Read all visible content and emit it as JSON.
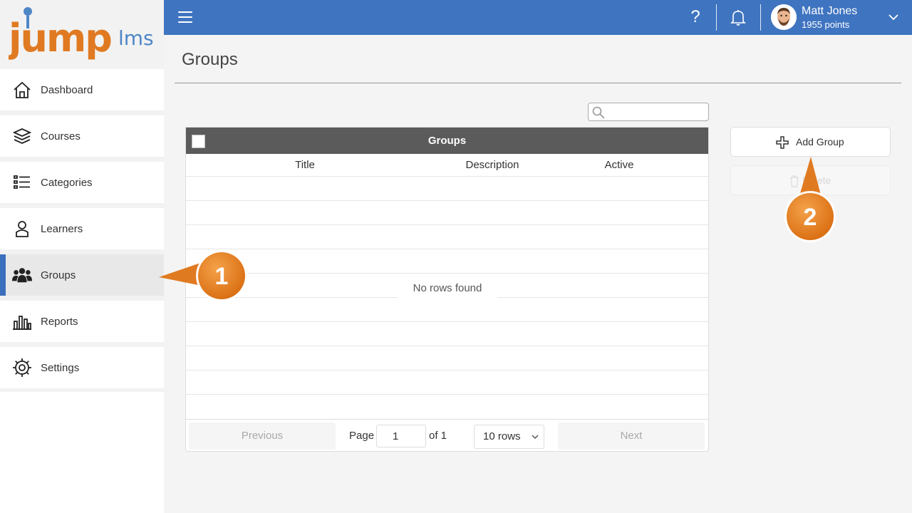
{
  "app": {
    "logo_text_main": "jump",
    "logo_text_sub": "lms",
    "colors": {
      "brand_orange": "#e07a22",
      "brand_blue": "#3f74c0",
      "callout_orange": "#e8821e"
    }
  },
  "sidebar": {
    "items": [
      {
        "label": "Dashboard",
        "icon": "home-icon",
        "active": false
      },
      {
        "label": "Courses",
        "icon": "book-stack-icon",
        "active": false
      },
      {
        "label": "Categories",
        "icon": "list-icon",
        "active": false
      },
      {
        "label": "Learners",
        "icon": "person-icon",
        "active": false
      },
      {
        "label": "Groups",
        "icon": "group-icon",
        "active": true
      },
      {
        "label": "Reports",
        "icon": "bar-chart-icon",
        "active": false
      },
      {
        "label": "Settings",
        "icon": "gear-icon",
        "active": false
      }
    ]
  },
  "topbar": {
    "help_glyph": "?",
    "user": {
      "name": "Matt Jones",
      "points": "1955 points"
    }
  },
  "main": {
    "page_title": "Groups",
    "search": {
      "placeholder": ""
    },
    "grid": {
      "title": "Groups",
      "columns": [
        "Title",
        "Description",
        "Active"
      ],
      "empty_message": "No rows found",
      "pager": {
        "previous_label": "Previous",
        "page_label": "Page",
        "page_value": "1",
        "of_label": "of 1",
        "rows_option": "10 rows",
        "next_label": "Next"
      }
    },
    "actions": {
      "add_label": "Add Group",
      "delete_label": "Delete"
    }
  },
  "callouts": [
    "1",
    "2"
  ]
}
